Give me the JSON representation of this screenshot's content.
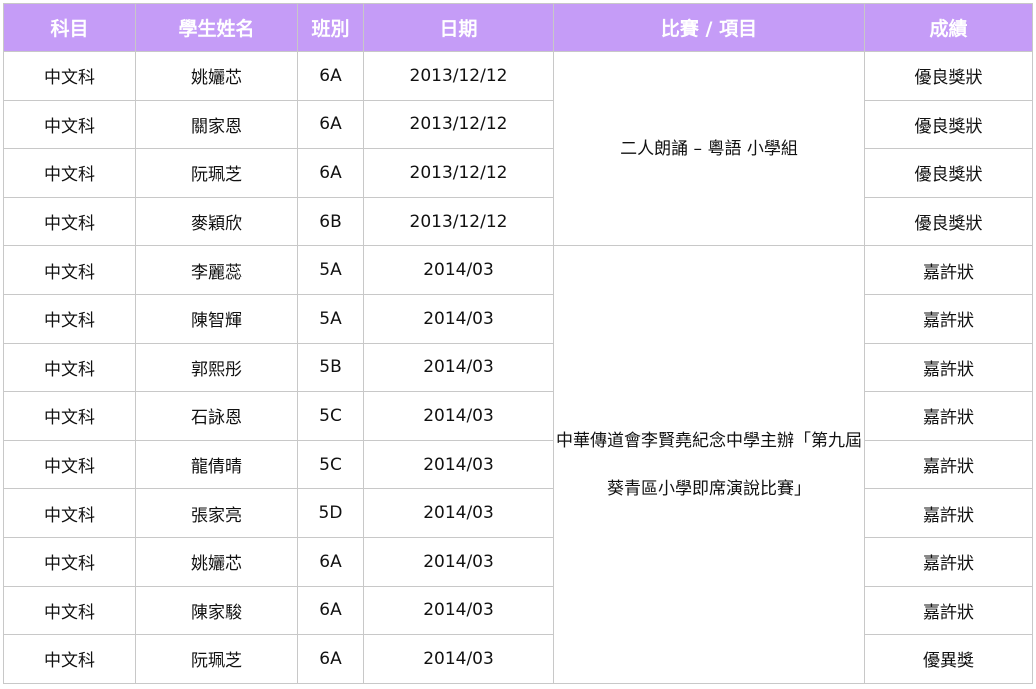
{
  "table": {
    "headers": [
      "科目",
      "學生姓名",
      "班別",
      "日期",
      "比賽 / 項目",
      "成績"
    ],
    "events": [
      {
        "label": "二人朗誦 – 粵語 小學組",
        "rowspan": 4
      },
      {
        "label": "中華傳道會李賢堯紀念中學主辦「第九屆葵青區小學即席演說比賽」",
        "rowspan": 9
      }
    ],
    "rows": [
      {
        "subject": "中文科",
        "name": "姚孋芯",
        "class": "6A",
        "date": "2013/12/12",
        "event": 0,
        "result": "優良獎狀"
      },
      {
        "subject": "中文科",
        "name": "關家恩",
        "class": "6A",
        "date": "2013/12/12",
        "event": 0,
        "result": "優良獎狀"
      },
      {
        "subject": "中文科",
        "name": "阮珮芝",
        "class": "6A",
        "date": "2013/12/12",
        "event": 0,
        "result": "優良獎狀"
      },
      {
        "subject": "中文科",
        "name": "麥穎欣",
        "class": "6B",
        "date": "2013/12/12",
        "event": 0,
        "result": "優良獎狀"
      },
      {
        "subject": "中文科",
        "name": "李麗蕊",
        "class": "5A",
        "date": "2014/03",
        "event": 1,
        "result": "嘉許狀"
      },
      {
        "subject": "中文科",
        "name": "陳智輝",
        "class": "5A",
        "date": "2014/03",
        "event": 1,
        "result": "嘉許狀"
      },
      {
        "subject": "中文科",
        "name": "郭熙彤",
        "class": "5B",
        "date": "2014/03",
        "event": 1,
        "result": "嘉許狀"
      },
      {
        "subject": "中文科",
        "name": "石詠恩",
        "class": "5C",
        "date": "2014/03",
        "event": 1,
        "result": "嘉許狀"
      },
      {
        "subject": "中文科",
        "name": "龍倩晴",
        "class": "5C",
        "date": "2014/03",
        "event": 1,
        "result": "嘉許狀"
      },
      {
        "subject": "中文科",
        "name": "張家亮",
        "class": "5D",
        "date": "2014/03",
        "event": 1,
        "result": "嘉許狀"
      },
      {
        "subject": "中文科",
        "name": "姚孋芯",
        "class": "6A",
        "date": "2014/03",
        "event": 1,
        "result": "嘉許狀"
      },
      {
        "subject": "中文科",
        "name": "陳家駿",
        "class": "6A",
        "date": "2014/03",
        "event": 1,
        "result": "嘉許狀"
      },
      {
        "subject": "中文科",
        "name": "阮珮芝",
        "class": "6A",
        "date": "2014/03",
        "event": 1,
        "result": "優異獎"
      }
    ]
  },
  "colors": {
    "header_bg": "#c59cf7",
    "header_text": "#ffffff",
    "border": "#c8c8c8"
  }
}
